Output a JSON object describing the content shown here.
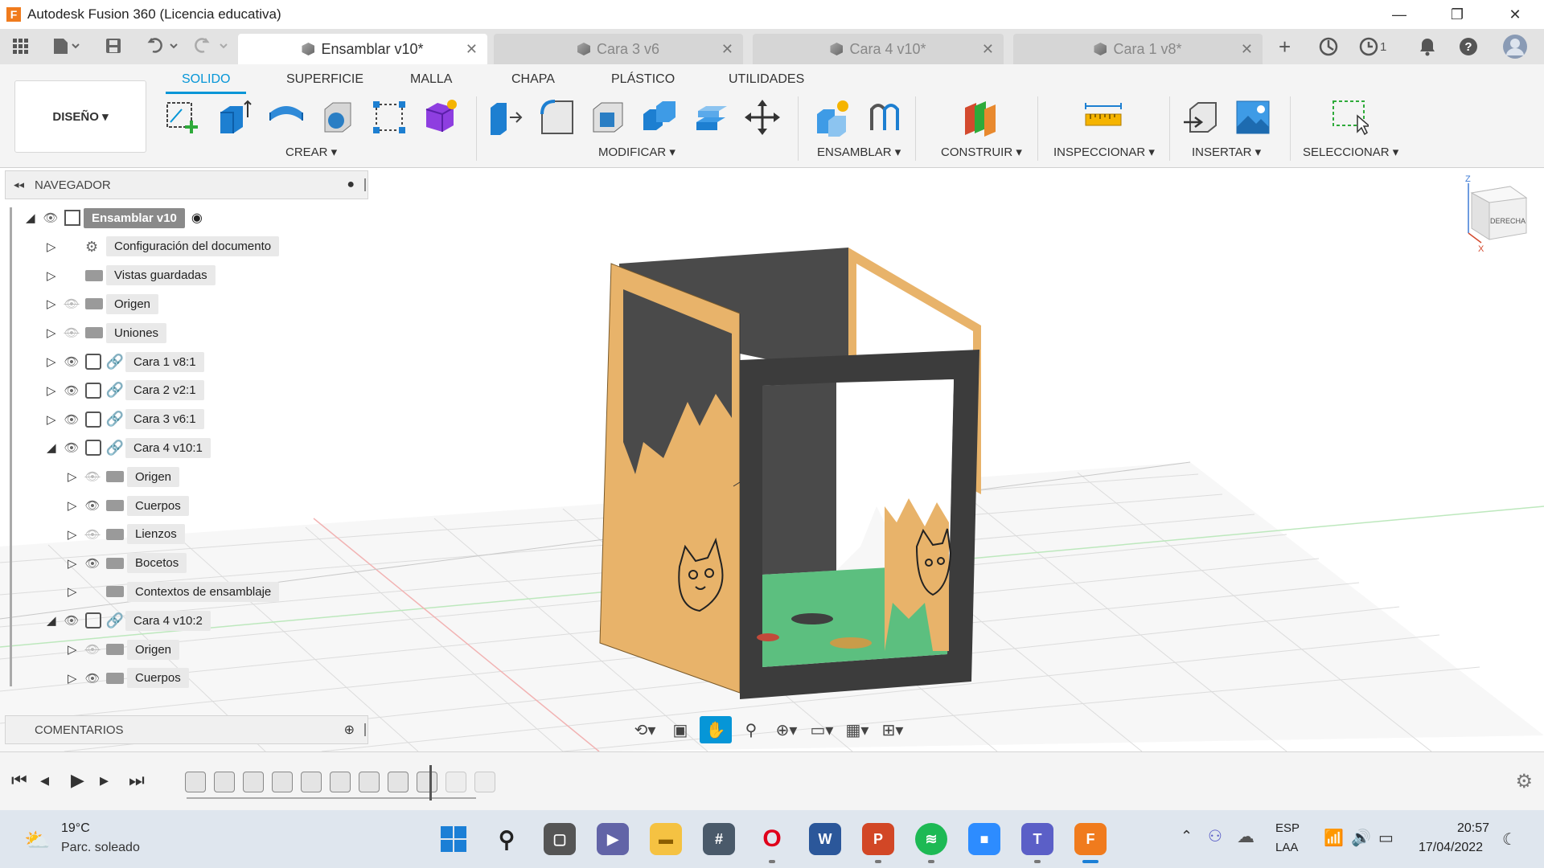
{
  "titlebar": {
    "app_icon": "F",
    "title": "Autodesk Fusion 360 (Licencia educativa)",
    "minimize": "—",
    "restore": "❐",
    "close": "✕"
  },
  "tabs": [
    {
      "label": "Ensamblar v10*",
      "active": true
    },
    {
      "label": "Cara 3 v6",
      "active": false
    },
    {
      "label": "Cara 4 v10*",
      "active": false
    },
    {
      "label": "Cara 1 v8*",
      "active": false
    }
  ],
  "appbar": {
    "jobs_count": "1"
  },
  "ribbon": {
    "tabs": [
      "SOLIDO",
      "SUPERFICIE",
      "MALLA",
      "CHAPA",
      "PLÁSTICO",
      "UTILIDADES"
    ],
    "workspace": "DISEÑO ▾",
    "groups": [
      "CREAR ▾",
      "MODIFICAR ▾",
      "ENSAMBLAR ▾",
      "CONSTRUIR ▾",
      "INSPECCIONAR ▾",
      "INSERTAR ▾",
      "SELECCIONAR ▾"
    ]
  },
  "navigator": {
    "title": "NAVEGADOR",
    "items": [
      {
        "label": "Ensamblar v10",
        "depth": 0,
        "expanded": true,
        "icon": "doc"
      },
      {
        "label": "Configuración del documento",
        "depth": 1,
        "icon": "gear"
      },
      {
        "label": "Vistas guardadas",
        "depth": 1,
        "icon": "folder"
      },
      {
        "label": "Origen",
        "depth": 1,
        "icon": "folder",
        "eye": "hidden"
      },
      {
        "label": "Uniones",
        "depth": 1,
        "icon": "folder",
        "eye": "hidden"
      },
      {
        "label": "Cara 1 v8:1",
        "depth": 1,
        "icon": "component",
        "eye": "visible",
        "link": true
      },
      {
        "label": "Cara 2 v2:1",
        "depth": 1,
        "icon": "component",
        "eye": "visible",
        "link": true
      },
      {
        "label": "Cara 3 v6:1",
        "depth": 1,
        "icon": "component",
        "eye": "visible",
        "link": true
      },
      {
        "label": "Cara 4 v10:1",
        "depth": 1,
        "icon": "component",
        "eye": "visible",
        "link": true,
        "expanded": true
      },
      {
        "label": "Origen",
        "depth": 2,
        "icon": "folder",
        "eye": "hidden"
      },
      {
        "label": "Cuerpos",
        "depth": 2,
        "icon": "folder",
        "eye": "visible"
      },
      {
        "label": "Lienzos",
        "depth": 2,
        "icon": "folder",
        "eye": "hidden"
      },
      {
        "label": "Bocetos",
        "depth": 2,
        "icon": "folder",
        "eye": "visible"
      },
      {
        "label": "Contextos de ensamblaje",
        "depth": 2,
        "icon": "folder"
      },
      {
        "label": "Cara 4 v10:2",
        "depth": 1,
        "icon": "component",
        "eye": "visible",
        "link": true,
        "expanded": true
      },
      {
        "label": "Origen",
        "depth": 2,
        "icon": "folder",
        "eye": "hidden"
      },
      {
        "label": "Cuerpos",
        "depth": 2,
        "icon": "folder",
        "eye": "visible"
      }
    ]
  },
  "comments": {
    "title": "COMENTARIOS"
  },
  "viewcube": {
    "face": "DERECHA",
    "axis_z": "Z",
    "axis_x": "X"
  },
  "taskbar": {
    "weather_temp": "19°C",
    "weather_desc": "Parc. soleado",
    "lang": "ESP",
    "layout": "LAA",
    "time": "20:57",
    "date": "17/04/2022"
  }
}
